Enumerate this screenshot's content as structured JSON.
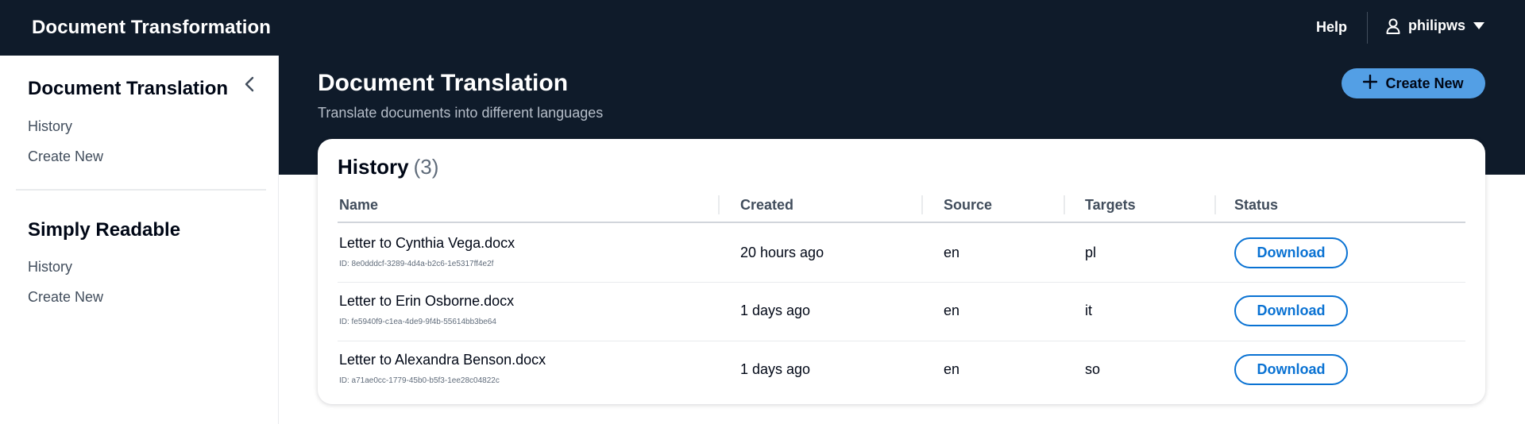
{
  "topnav": {
    "brand": "Document Transformation",
    "help": "Help",
    "username": "philipws"
  },
  "sidebar": {
    "sections": [
      {
        "title": "Document Translation",
        "items": [
          {
            "label": "History"
          },
          {
            "label": "Create New"
          }
        ]
      },
      {
        "title": "Simply Readable",
        "items": [
          {
            "label": "History"
          },
          {
            "label": "Create New"
          }
        ]
      }
    ]
  },
  "header": {
    "title": "Document Translation",
    "subtitle": "Translate documents into different languages",
    "create_new_label": "Create New"
  },
  "history": {
    "title": "History",
    "count": "(3)",
    "columns": [
      "Name",
      "Created",
      "Source",
      "Targets",
      "Status"
    ],
    "rows": [
      {
        "name": "Letter to Cynthia Vega.docx",
        "id": "ID: 8e0dddcf-3289-4d4a-b2c6-1e5317ff4e2f",
        "created": "20 hours ago",
        "source": "en",
        "targets": "pl",
        "status": "Download"
      },
      {
        "name": "Letter to Erin Osborne.docx",
        "id": "ID: fe5940f9-c1ea-4de9-9f4b-55614bb3be64",
        "created": "1 days ago",
        "source": "en",
        "targets": "it",
        "status": "Download"
      },
      {
        "name": "Letter to Alexandra Benson.docx",
        "id": "ID: a71ae0cc-1779-45b0-b5f3-1ee28c04822c",
        "created": "1 days ago",
        "source": "en",
        "targets": "so",
        "status": "Download"
      }
    ]
  },
  "colors": {
    "nav_bg": "#0f1b2a",
    "primary_button": "#539fe5",
    "link_blue": "#0972d3"
  },
  "icons": {
    "user": "user-icon",
    "caret": "caret-down-icon",
    "collapse": "chevron-left-icon",
    "add": "plus-icon"
  }
}
